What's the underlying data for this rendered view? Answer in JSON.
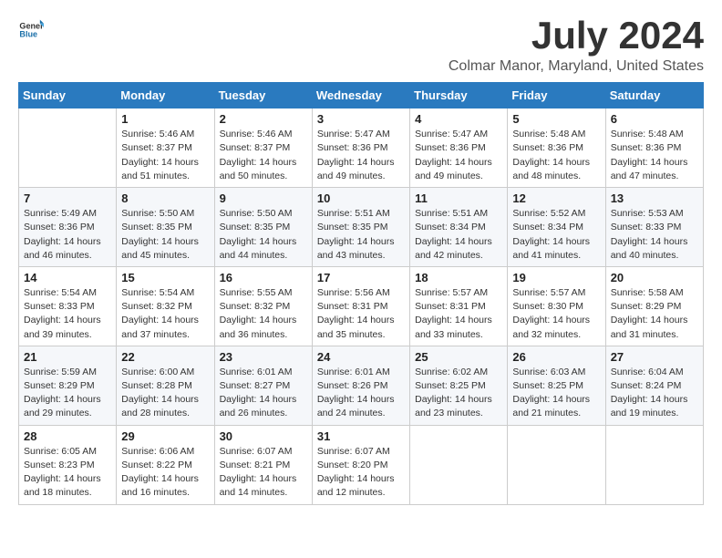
{
  "header": {
    "logo_general": "General",
    "logo_blue": "Blue",
    "month_title": "July 2024",
    "location": "Colmar Manor, Maryland, United States"
  },
  "weekdays": [
    "Sunday",
    "Monday",
    "Tuesday",
    "Wednesday",
    "Thursday",
    "Friday",
    "Saturday"
  ],
  "weeks": [
    [
      {
        "day": "",
        "info": ""
      },
      {
        "day": "1",
        "info": "Sunrise: 5:46 AM\nSunset: 8:37 PM\nDaylight: 14 hours\nand 51 minutes."
      },
      {
        "day": "2",
        "info": "Sunrise: 5:46 AM\nSunset: 8:37 PM\nDaylight: 14 hours\nand 50 minutes."
      },
      {
        "day": "3",
        "info": "Sunrise: 5:47 AM\nSunset: 8:36 PM\nDaylight: 14 hours\nand 49 minutes."
      },
      {
        "day": "4",
        "info": "Sunrise: 5:47 AM\nSunset: 8:36 PM\nDaylight: 14 hours\nand 49 minutes."
      },
      {
        "day": "5",
        "info": "Sunrise: 5:48 AM\nSunset: 8:36 PM\nDaylight: 14 hours\nand 48 minutes."
      },
      {
        "day": "6",
        "info": "Sunrise: 5:48 AM\nSunset: 8:36 PM\nDaylight: 14 hours\nand 47 minutes."
      }
    ],
    [
      {
        "day": "7",
        "info": "Sunrise: 5:49 AM\nSunset: 8:36 PM\nDaylight: 14 hours\nand 46 minutes."
      },
      {
        "day": "8",
        "info": "Sunrise: 5:50 AM\nSunset: 8:35 PM\nDaylight: 14 hours\nand 45 minutes."
      },
      {
        "day": "9",
        "info": "Sunrise: 5:50 AM\nSunset: 8:35 PM\nDaylight: 14 hours\nand 44 minutes."
      },
      {
        "day": "10",
        "info": "Sunrise: 5:51 AM\nSunset: 8:35 PM\nDaylight: 14 hours\nand 43 minutes."
      },
      {
        "day": "11",
        "info": "Sunrise: 5:51 AM\nSunset: 8:34 PM\nDaylight: 14 hours\nand 42 minutes."
      },
      {
        "day": "12",
        "info": "Sunrise: 5:52 AM\nSunset: 8:34 PM\nDaylight: 14 hours\nand 41 minutes."
      },
      {
        "day": "13",
        "info": "Sunrise: 5:53 AM\nSunset: 8:33 PM\nDaylight: 14 hours\nand 40 minutes."
      }
    ],
    [
      {
        "day": "14",
        "info": "Sunrise: 5:54 AM\nSunset: 8:33 PM\nDaylight: 14 hours\nand 39 minutes."
      },
      {
        "day": "15",
        "info": "Sunrise: 5:54 AM\nSunset: 8:32 PM\nDaylight: 14 hours\nand 37 minutes."
      },
      {
        "day": "16",
        "info": "Sunrise: 5:55 AM\nSunset: 8:32 PM\nDaylight: 14 hours\nand 36 minutes."
      },
      {
        "day": "17",
        "info": "Sunrise: 5:56 AM\nSunset: 8:31 PM\nDaylight: 14 hours\nand 35 minutes."
      },
      {
        "day": "18",
        "info": "Sunrise: 5:57 AM\nSunset: 8:31 PM\nDaylight: 14 hours\nand 33 minutes."
      },
      {
        "day": "19",
        "info": "Sunrise: 5:57 AM\nSunset: 8:30 PM\nDaylight: 14 hours\nand 32 minutes."
      },
      {
        "day": "20",
        "info": "Sunrise: 5:58 AM\nSunset: 8:29 PM\nDaylight: 14 hours\nand 31 minutes."
      }
    ],
    [
      {
        "day": "21",
        "info": "Sunrise: 5:59 AM\nSunset: 8:29 PM\nDaylight: 14 hours\nand 29 minutes."
      },
      {
        "day": "22",
        "info": "Sunrise: 6:00 AM\nSunset: 8:28 PM\nDaylight: 14 hours\nand 28 minutes."
      },
      {
        "day": "23",
        "info": "Sunrise: 6:01 AM\nSunset: 8:27 PM\nDaylight: 14 hours\nand 26 minutes."
      },
      {
        "day": "24",
        "info": "Sunrise: 6:01 AM\nSunset: 8:26 PM\nDaylight: 14 hours\nand 24 minutes."
      },
      {
        "day": "25",
        "info": "Sunrise: 6:02 AM\nSunset: 8:25 PM\nDaylight: 14 hours\nand 23 minutes."
      },
      {
        "day": "26",
        "info": "Sunrise: 6:03 AM\nSunset: 8:25 PM\nDaylight: 14 hours\nand 21 minutes."
      },
      {
        "day": "27",
        "info": "Sunrise: 6:04 AM\nSunset: 8:24 PM\nDaylight: 14 hours\nand 19 minutes."
      }
    ],
    [
      {
        "day": "28",
        "info": "Sunrise: 6:05 AM\nSunset: 8:23 PM\nDaylight: 14 hours\nand 18 minutes."
      },
      {
        "day": "29",
        "info": "Sunrise: 6:06 AM\nSunset: 8:22 PM\nDaylight: 14 hours\nand 16 minutes."
      },
      {
        "day": "30",
        "info": "Sunrise: 6:07 AM\nSunset: 8:21 PM\nDaylight: 14 hours\nand 14 minutes."
      },
      {
        "day": "31",
        "info": "Sunrise: 6:07 AM\nSunset: 8:20 PM\nDaylight: 14 hours\nand 12 minutes."
      },
      {
        "day": "",
        "info": ""
      },
      {
        "day": "",
        "info": ""
      },
      {
        "day": "",
        "info": ""
      }
    ]
  ]
}
